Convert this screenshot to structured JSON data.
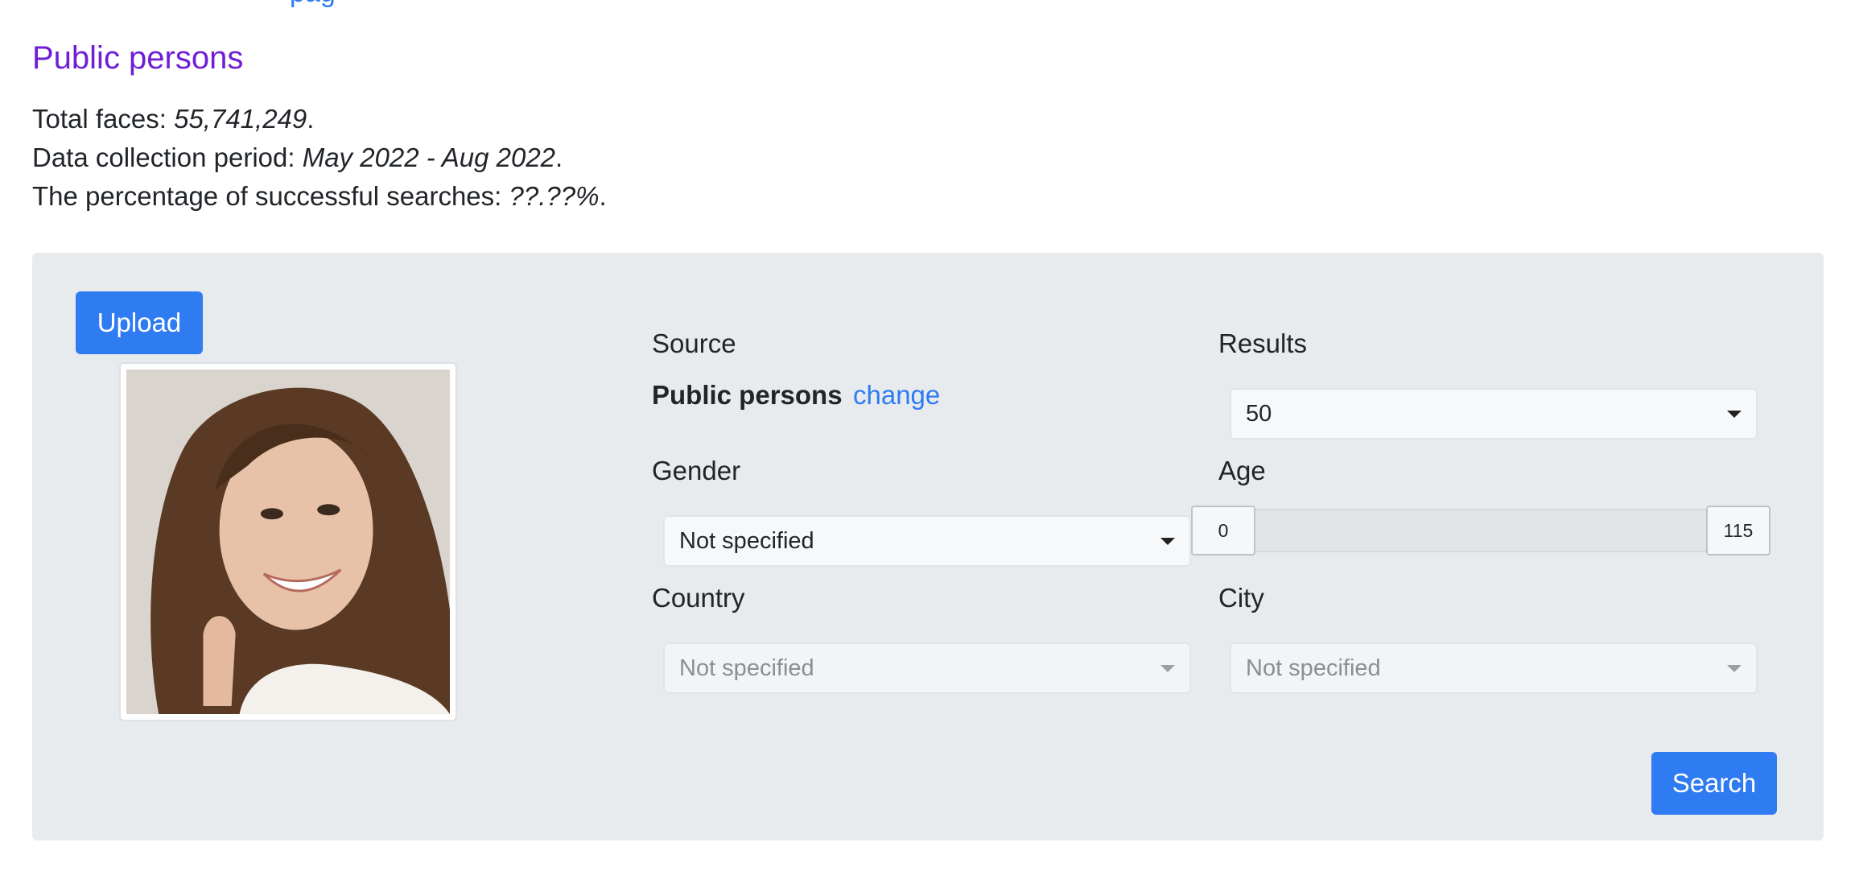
{
  "header": {
    "top_link_fragment": "pag",
    "title": "Public persons"
  },
  "stats": {
    "total_faces_label": "Total faces: ",
    "total_faces_value": "55,741,249",
    "period_label": "Data collection period: ",
    "period_value": "May 2022 - Aug 2022",
    "success_label": "The percentage of successful searches: ",
    "success_value": "??.??%",
    "suffix": "."
  },
  "form": {
    "upload_label": "Upload",
    "source_label": "Source",
    "source_value": "Public persons",
    "change_label": "change",
    "results_label": "Results",
    "results_value": "50",
    "gender_label": "Gender",
    "gender_value": "Not specified",
    "age_label": "Age",
    "age_min": "0",
    "age_max": "115",
    "country_label": "Country",
    "country_value": "Not specified",
    "city_label": "City",
    "city_value": "Not specified",
    "search_label": "Search"
  },
  "colors": {
    "accent": "#2f7bf2",
    "title": "#6f1ed6",
    "panel": "#e8ebee"
  }
}
